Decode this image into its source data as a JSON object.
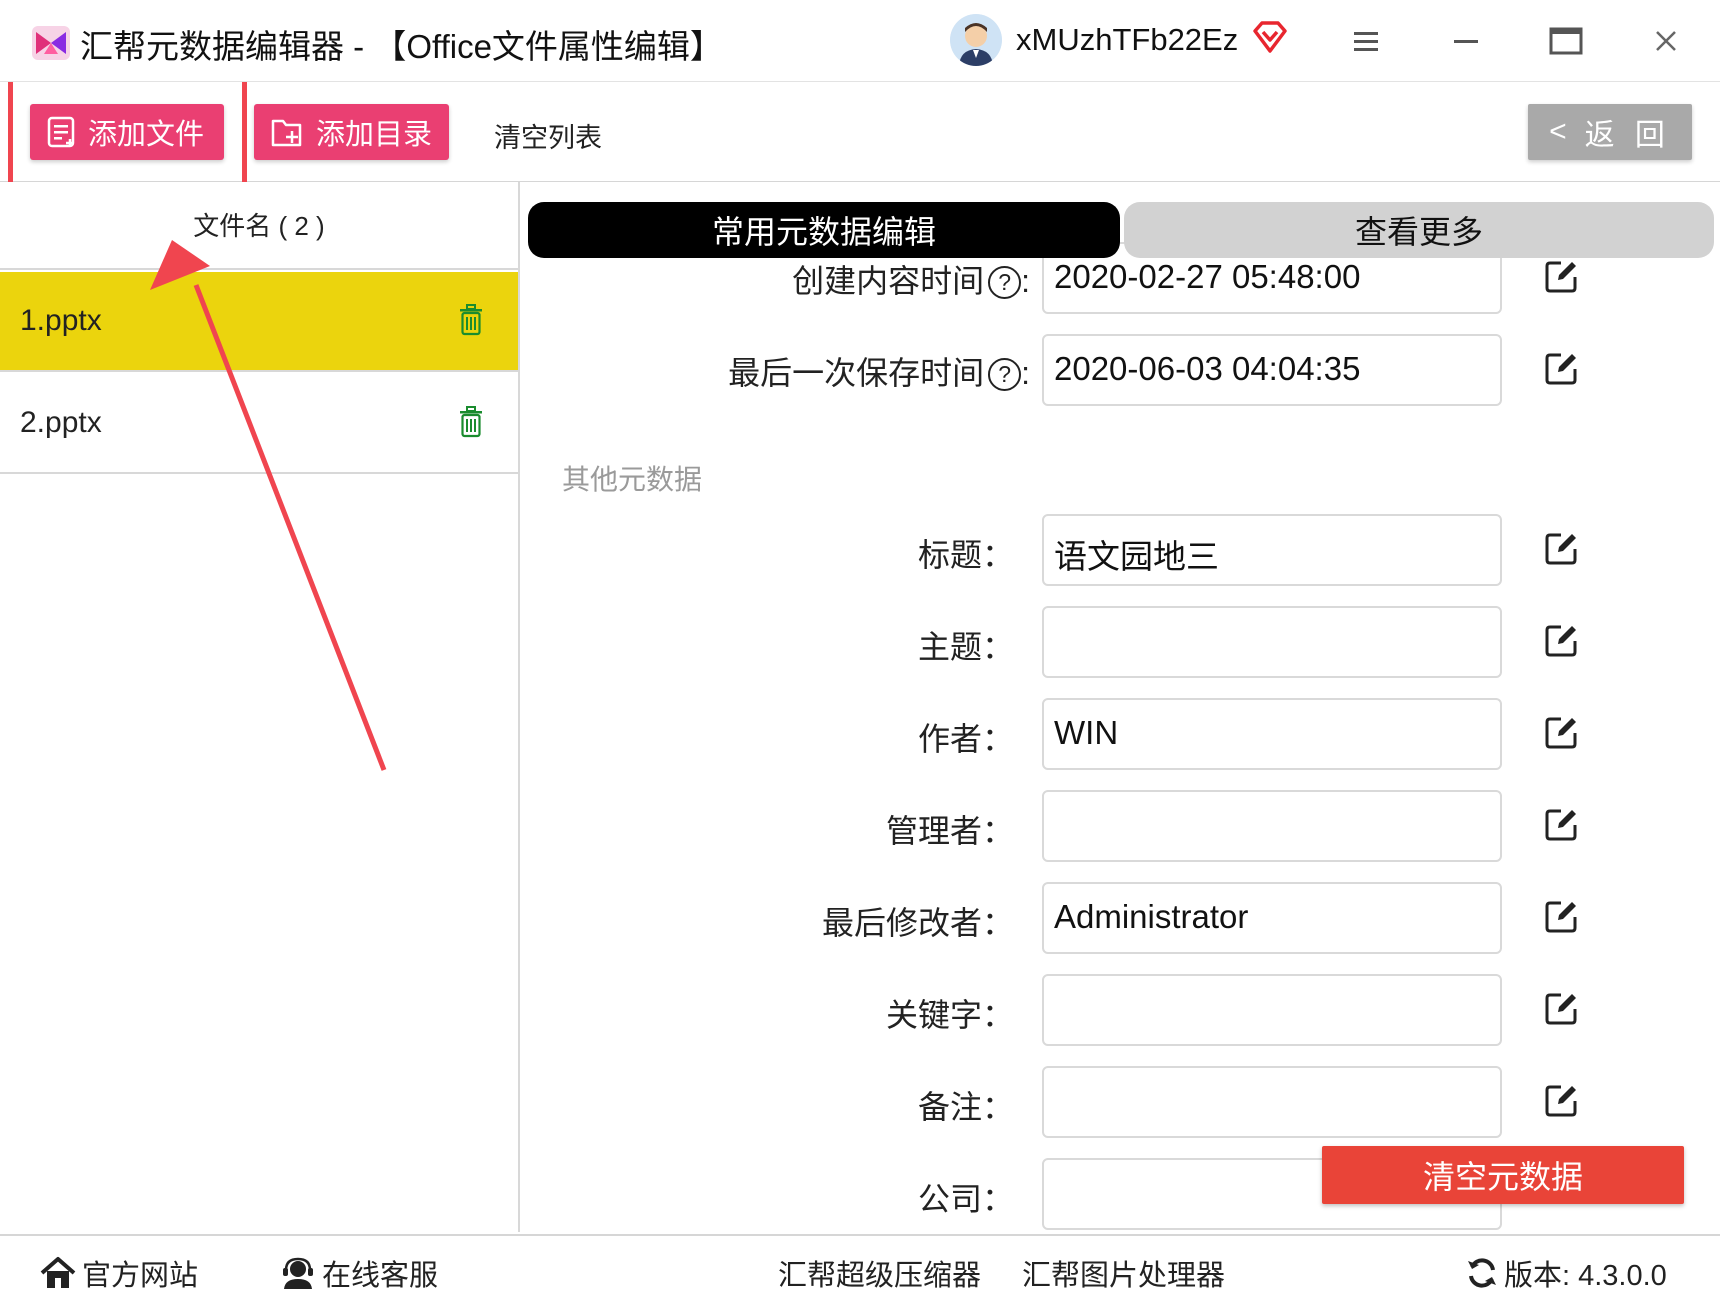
{
  "window": {
    "title": "汇帮元数据编辑器 - 【Office文件属性编辑】",
    "username": "xMUzhTFb22Ez"
  },
  "toolbar": {
    "add_file": "添加文件",
    "add_dir": "添加目录",
    "clear_list": "清空列表",
    "back": "返 回"
  },
  "file_list": {
    "header": "文件名 ( 2 )",
    "files": [
      {
        "name": "1.pptx",
        "selected": true
      },
      {
        "name": "2.pptx",
        "selected": false
      }
    ]
  },
  "tabs": {
    "common": "常用元数据编辑",
    "more": "查看更多"
  },
  "form": {
    "created_label": "创建内容时间",
    "created_value": "2020-02-27 05:48:00",
    "saved_label": "最后一次保存时间",
    "saved_value": "2020-06-03 04:04:35",
    "help_glyph": "?",
    "colon": ":",
    "section_other": "其他元数据",
    "fields": [
      {
        "label": "标题：",
        "value": "语文园地三"
      },
      {
        "label": "主题：",
        "value": ""
      },
      {
        "label": "作者：",
        "value": "WIN"
      },
      {
        "label": "管理者：",
        "value": ""
      },
      {
        "label": "最后修改者：",
        "value": "Administrator"
      },
      {
        "label": "关键字：",
        "value": ""
      },
      {
        "label": "备注：",
        "value": ""
      },
      {
        "label": "公司：",
        "value": ""
      }
    ],
    "clear_meta": "清空元数据"
  },
  "footer": {
    "website": "官方网站",
    "support": "在线客服",
    "compressor": "汇帮超级压缩器",
    "image_tool": "汇帮图片处理器",
    "version": "版本:  4.3.0.0"
  },
  "colors": {
    "pink_button": "#ea3f72",
    "selected_row": "#ebd40d",
    "annotation_red": "#f0454f",
    "clear_button": "#e94438"
  }
}
